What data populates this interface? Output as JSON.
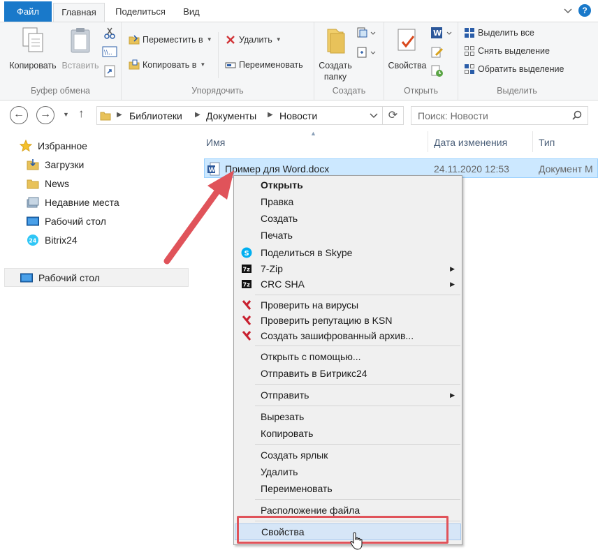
{
  "tabs": {
    "file": "Файл",
    "home": "Главная",
    "share": "Поделиться",
    "view": "Вид"
  },
  "ribbon": {
    "clipboard": {
      "label": "Буфер обмена",
      "copy": "Копировать",
      "paste": "Вставить"
    },
    "organize": {
      "label": "Упорядочить",
      "move_to": "Переместить в",
      "copy_to": "Копировать в",
      "delete": "Удалить",
      "rename": "Переименовать"
    },
    "create": {
      "label": "Создать",
      "new_folder_line1": "Создать",
      "new_folder_line2": "папку"
    },
    "open": {
      "label": "Открыть",
      "properties": "Свойства"
    },
    "select": {
      "label": "Выделить",
      "select_all": "Выделить все",
      "select_none": "Снять выделение",
      "invert": "Обратить выделение"
    }
  },
  "address": {
    "crumbs": [
      "Библиотеки",
      "Документы",
      "Новости"
    ],
    "search_placeholder": "Поиск: Новости"
  },
  "nav": {
    "favorites": "Избранное",
    "items": [
      "Загрузки",
      "News",
      "Недавние места",
      "Рабочий стол",
      "Bitrix24"
    ],
    "desktop": "Рабочий стол"
  },
  "columns": {
    "name": "Имя",
    "date": "Дата изменения",
    "type": "Тип"
  },
  "file": {
    "name": "Пример для Word.docx",
    "date": "24.11.2020 12:53",
    "type": "Документ M"
  },
  "menu": {
    "open": "Открыть",
    "edit": "Правка",
    "new": "Создать",
    "print": "Печать",
    "skype": "Поделиться в Skype",
    "zip": "7-Zip",
    "crc": "CRC SHA",
    "scan": "Проверить на вирусы",
    "reputation": "Проверить репутацию в KSN",
    "encrypt": "Создать зашифрованный архив...",
    "open_with": "Открыть с помощью...",
    "send_bitrix": "Отправить в Битрикс24",
    "send_to": "Отправить",
    "cut": "Вырезать",
    "copy": "Копировать",
    "shortcut": "Создать ярлык",
    "delete": "Удалить",
    "rename": "Переименовать",
    "location": "Расположение файла",
    "properties": "Свойства"
  },
  "colors": {
    "accent": "#1979ca",
    "selection": "#cce8ff",
    "highlight_red": "#e0535a"
  }
}
